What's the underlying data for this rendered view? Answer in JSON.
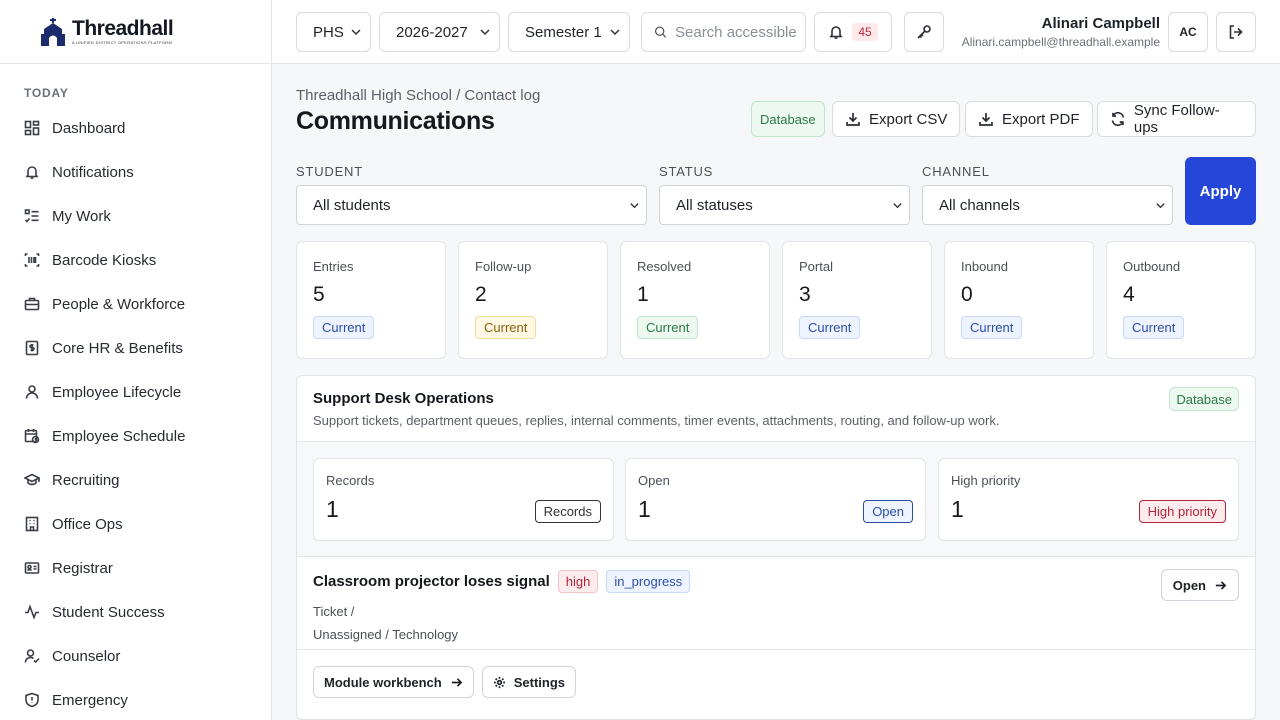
{
  "brand": {
    "name": "Threadhall",
    "tagline": "A unified district operations platform"
  },
  "sidebar": {
    "section": "TODAY",
    "items": [
      {
        "label": "Dashboard",
        "icon": "grid-icon"
      },
      {
        "label": "Notifications",
        "icon": "bell-icon"
      },
      {
        "label": "My Work",
        "icon": "checklist-icon"
      },
      {
        "label": "Barcode Kiosks",
        "icon": "barcode-icon"
      },
      {
        "label": "People & Workforce",
        "icon": "briefcase-icon"
      },
      {
        "label": "Core HR & Benefits",
        "icon": "receipt-icon"
      },
      {
        "label": "Employee Lifecycle",
        "icon": "user-icon"
      },
      {
        "label": "Employee Schedule",
        "icon": "calendar-clock-icon"
      },
      {
        "label": "Recruiting",
        "icon": "graduation-cap-icon"
      },
      {
        "label": "Office Ops",
        "icon": "building-icon"
      },
      {
        "label": "Registrar",
        "icon": "id-card-icon"
      },
      {
        "label": "Student Success",
        "icon": "activity-icon"
      },
      {
        "label": "Counselor",
        "icon": "user-check-icon"
      },
      {
        "label": "Emergency",
        "icon": "shield-alert-icon"
      }
    ]
  },
  "topbar": {
    "school": "PHS",
    "year": "2026-2027",
    "term": "Semester 1",
    "search_placeholder": "Search accessible",
    "notifications_count": "45",
    "user_name": "Alinari Campbell",
    "user_email": "Alinari.campbell@threadhall.example",
    "avatar": "AC"
  },
  "page": {
    "breadcrumb": "Threadhall High School / Contact log",
    "title": "Communications",
    "source_badge": "Database",
    "actions": {
      "export_csv": "Export CSV",
      "export_pdf": "Export PDF",
      "sync": "Sync Follow-ups"
    }
  },
  "filters": {
    "student_label": "STUDENT",
    "student_value": "All students",
    "status_label": "STATUS",
    "status_value": "All statuses",
    "channel_label": "CHANNEL",
    "channel_value": "All channels",
    "apply": "Apply"
  },
  "stats": [
    {
      "label": "Entries",
      "value": "5",
      "pill": "Current",
      "tone": "blue"
    },
    {
      "label": "Follow-up",
      "value": "2",
      "pill": "Current",
      "tone": "yellow"
    },
    {
      "label": "Resolved",
      "value": "1",
      "pill": "Current",
      "tone": "green"
    },
    {
      "label": "Portal",
      "value": "3",
      "pill": "Current",
      "tone": "blue"
    },
    {
      "label": "Inbound",
      "value": "0",
      "pill": "Current",
      "tone": "blue"
    },
    {
      "label": "Outbound",
      "value": "4",
      "pill": "Current",
      "tone": "blue"
    }
  ],
  "support": {
    "title": "Support Desk Operations",
    "description": "Support tickets, department queues, replies, internal comments, timer events, attachments, routing, and follow-up work.",
    "badge": "Database",
    "metrics": [
      {
        "label": "Records",
        "value": "1",
        "tag": "Records"
      },
      {
        "label": "Open",
        "value": "1",
        "tag": "Open"
      },
      {
        "label": "High priority",
        "value": "1",
        "tag": "High priority"
      }
    ],
    "ticket": {
      "title": "Classroom projector loses signal",
      "priority": "high",
      "status": "in_progress",
      "type_line": "Ticket /",
      "assignment_line": "Unassigned / Technology",
      "open_label": "Open"
    },
    "footer": {
      "workbench": "Module workbench",
      "settings": "Settings"
    }
  }
}
